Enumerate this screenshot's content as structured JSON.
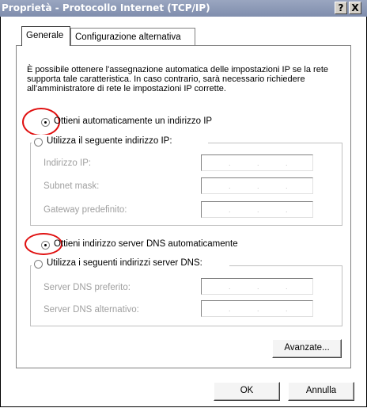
{
  "window": {
    "title": "Proprietà - Protocollo Internet (TCP/IP)",
    "help_button": "?",
    "close_button": "X"
  },
  "tabs": [
    {
      "label": "Generale",
      "active": true
    },
    {
      "label": "Configurazione alternativa",
      "active": false
    }
  ],
  "intro_text": "È possibile ottenere l'assegnazione automatica delle impostazioni IP se la rete supporta tale caratteristica. In caso contrario, sarà necessario richiedere all'amministratore di rete le impostazioni IP corrette.",
  "ip_section": {
    "auto_label": "Ottieni automaticamente un indirizzo IP",
    "auto_selected": true,
    "manual_label": "Utilizza il seguente indirizzo IP:",
    "fields": [
      {
        "label": "Indirizzo IP:",
        "value": ""
      },
      {
        "label": "Subnet mask:",
        "value": ""
      },
      {
        "label": "Gateway predefinito:",
        "value": ""
      }
    ]
  },
  "dns_section": {
    "auto_label": "Ottieni indirizzo server DNS automaticamente",
    "auto_selected": true,
    "manual_label": "Utilizza i seguenti indirizzi server DNS:",
    "fields": [
      {
        "label": "Server DNS preferito:",
        "value": ""
      },
      {
        "label": "Server DNS alternativo:",
        "value": ""
      }
    ]
  },
  "buttons": {
    "advanced": "Avanzate...",
    "ok": "OK",
    "cancel": "Annulla"
  },
  "colors": {
    "annotation_ring": "#e01010",
    "titlebar": "#8390b0"
  }
}
